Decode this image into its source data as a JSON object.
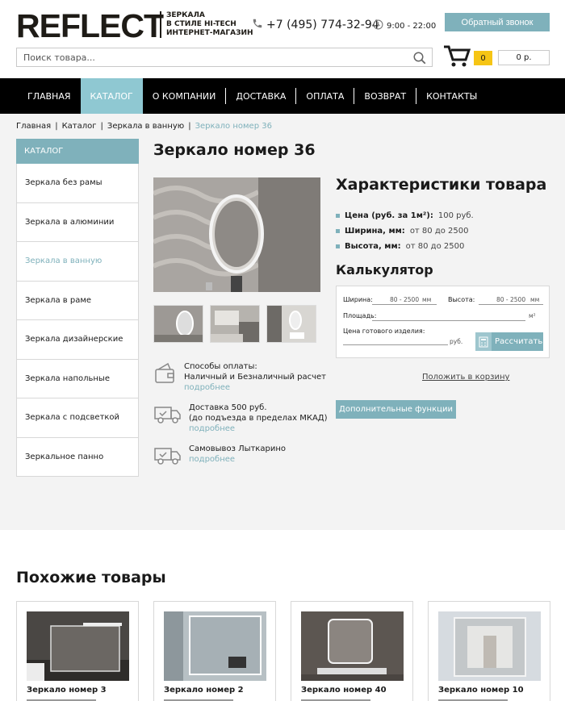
{
  "header": {
    "logo": "REFLECT",
    "tagline": [
      "ЗЕРКАЛА",
      "В СТИЛЕ HI-TECH",
      "ИНТЕРНЕТ-МАГАЗИН"
    ],
    "phone": "+7 (495) 774-32-94",
    "hours": "9:00 - 22:00",
    "callback_label": "Обратный звонок",
    "search_placeholder": "Поиск товара...",
    "cart_count": "0",
    "cart_sum": "0 р."
  },
  "nav": {
    "items": [
      {
        "label": "ГЛАВНАЯ"
      },
      {
        "label": "КАТАЛОГ",
        "active": true
      },
      {
        "label": "О КОМПАНИИ"
      },
      {
        "label": "ДОСТАВКА"
      },
      {
        "label": "ОПЛАТА"
      },
      {
        "label": "ВОЗВРАТ"
      },
      {
        "label": "КОНТАКТЫ"
      }
    ]
  },
  "breadcrumb": {
    "items": [
      "Главная",
      "Каталог",
      "Зеркала в ванную"
    ],
    "current": "Зеркало номер 36"
  },
  "sidebar": {
    "heading": "КАТАЛОГ",
    "items": [
      "Зеркала без рамы",
      "Зеркала в алюминии",
      "Зеркала в ванную",
      "Зеркала в раме",
      "Зеркала дизайнерские",
      "Зеркала напольные",
      "Зеркала с подсветкой",
      "Зеркальное панно"
    ],
    "active_index": 2
  },
  "product": {
    "title": "Зеркало номер 36",
    "info": [
      {
        "line1": "Способы оплаты:",
        "line2": "Наличный и Безналичный расчет",
        "more": "подробнее"
      },
      {
        "line1": "Доставка 500 руб.",
        "line2": "(до подъезда в пределах МКАД)",
        "more": "подробнее"
      },
      {
        "line1": "Самовывоз Лыткарино",
        "line2": "",
        "more": "подробнее"
      }
    ]
  },
  "specs": {
    "title": "Характеристики товара",
    "rows": [
      {
        "k": "Цена (руб. за 1м²):",
        "v": "100 руб."
      },
      {
        "k": "Ширина, мм:",
        "v": "от 80 до 2500"
      },
      {
        "k": "Высота, мм:",
        "v": "от 80 до 2500"
      }
    ]
  },
  "calculator": {
    "title": "Калькулятор",
    "width_label": "Ширина:",
    "width_hint": "80 - 2500",
    "width_unit": "мм",
    "height_label": "Высота:",
    "height_hint": "80 - 2500",
    "height_unit": "мм",
    "area_label": "Площадь:",
    "area_unit": "м²",
    "price_label": "Цена готового изделия:",
    "price_unit": "руб.",
    "calc_button": "Рассчитать",
    "to_cart": "Положить в корзину",
    "extra_button": "Дополнительные функции"
  },
  "similar": {
    "title": "Похожие товары",
    "items": [
      "Зеркало номер 3",
      "Зеркало номер 2",
      "Зеркало номер 40",
      "Зеркало номер 10"
    ]
  }
}
